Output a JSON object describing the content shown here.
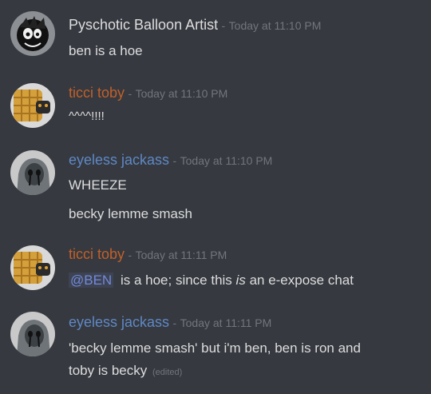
{
  "colors": {
    "background": "#36393f",
    "text": "#dcddde",
    "muted": "#72767d",
    "user_white": "#dcddde",
    "user_orange": "#c0602b",
    "user_blue": "#5f88c5",
    "mention": "#7289da"
  },
  "separator": "-",
  "messages": [
    {
      "username": "Pyschotic Balloon Artist",
      "timestamp": "Today at 11:10 PM",
      "avatar": "dark-clown-avatar",
      "lines": [
        "ben is a hoe"
      ]
    },
    {
      "username": "ticci toby",
      "timestamp": "Today at 11:10 PM",
      "avatar": "waffle-avatar",
      "lines": [
        "^^^^!!!!"
      ]
    },
    {
      "username": "eyeless jackass",
      "timestamp": "Today at 11:10 PM",
      "avatar": "grey-mask-avatar",
      "lines": [
        "WHEEZE",
        "becky lemme smash"
      ]
    },
    {
      "username": "ticci toby",
      "timestamp": "Today at 11:11 PM",
      "avatar": "waffle-avatar",
      "mention": "@BEN",
      "text_before_italic": "is a hoe; since this",
      "italic": "is",
      "text_after_italic": "an e-expose chat"
    },
    {
      "username": "eyeless jackass",
      "timestamp": "Today at 11:11 PM",
      "avatar": "grey-mask-avatar",
      "lines": [
        "'becky lemme smash' but i'm ben, ben is ron and",
        "toby is becky"
      ],
      "edited": "(edited)"
    }
  ]
}
